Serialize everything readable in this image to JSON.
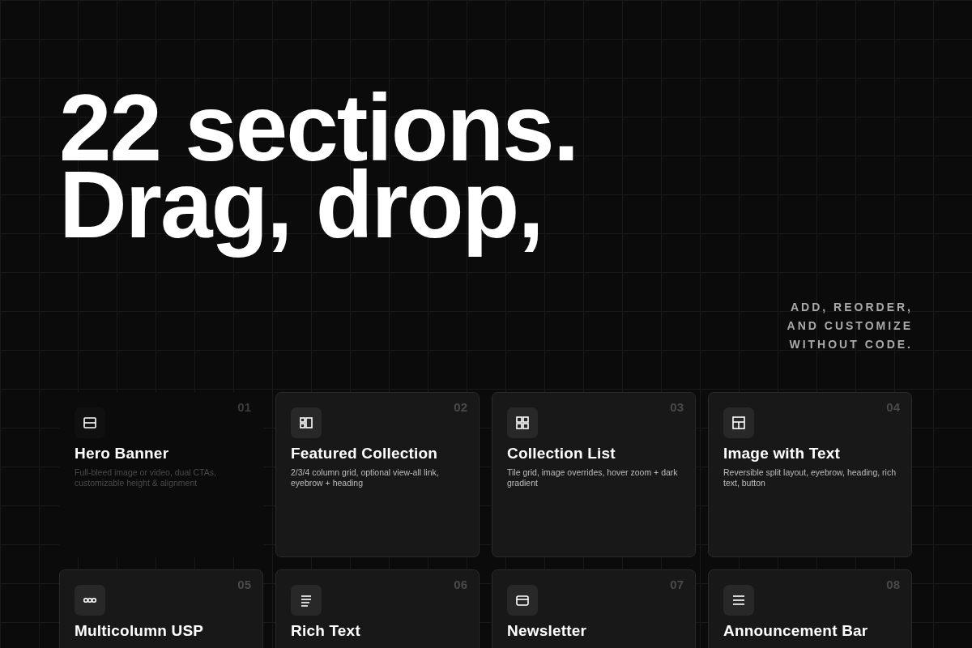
{
  "headline": [
    "22 sections.",
    "Drag, drop,"
  ],
  "tagline": [
    "ADD, REORDER,",
    "AND CUSTOMIZE",
    "WITHOUT CODE."
  ],
  "sections": [
    {
      "number": "01",
      "title": "Hero Banner",
      "description": "Full-bleed image or video, dual CTAs, customizable height & alignment",
      "kind": "banner",
      "faded": true
    },
    {
      "number": "02",
      "title": "Featured Collection",
      "description": "2/3/4 column grid, optional view-all link, eyebrow + heading",
      "kind": "featured",
      "faded": false
    },
    {
      "number": "03",
      "title": "Collection List",
      "description": "Tile grid, image overrides, hover zoom + dark gradient",
      "kind": "grid",
      "faded": false
    },
    {
      "number": "04",
      "title": "Image with Text",
      "description": "Reversible split layout, eyebrow, heading, rich text, button",
      "kind": "split",
      "faded": false
    },
    {
      "number": "05",
      "title": "Multicolumn USP",
      "kind": "dots",
      "faded": false
    },
    {
      "number": "06",
      "title": "Rich Text",
      "kind": "text",
      "faded": false
    },
    {
      "number": "07",
      "title": "Newsletter",
      "kind": "card",
      "faded": false
    },
    {
      "number": "08",
      "title": "Announcement Bar",
      "kind": "lines",
      "faded": false
    }
  ]
}
